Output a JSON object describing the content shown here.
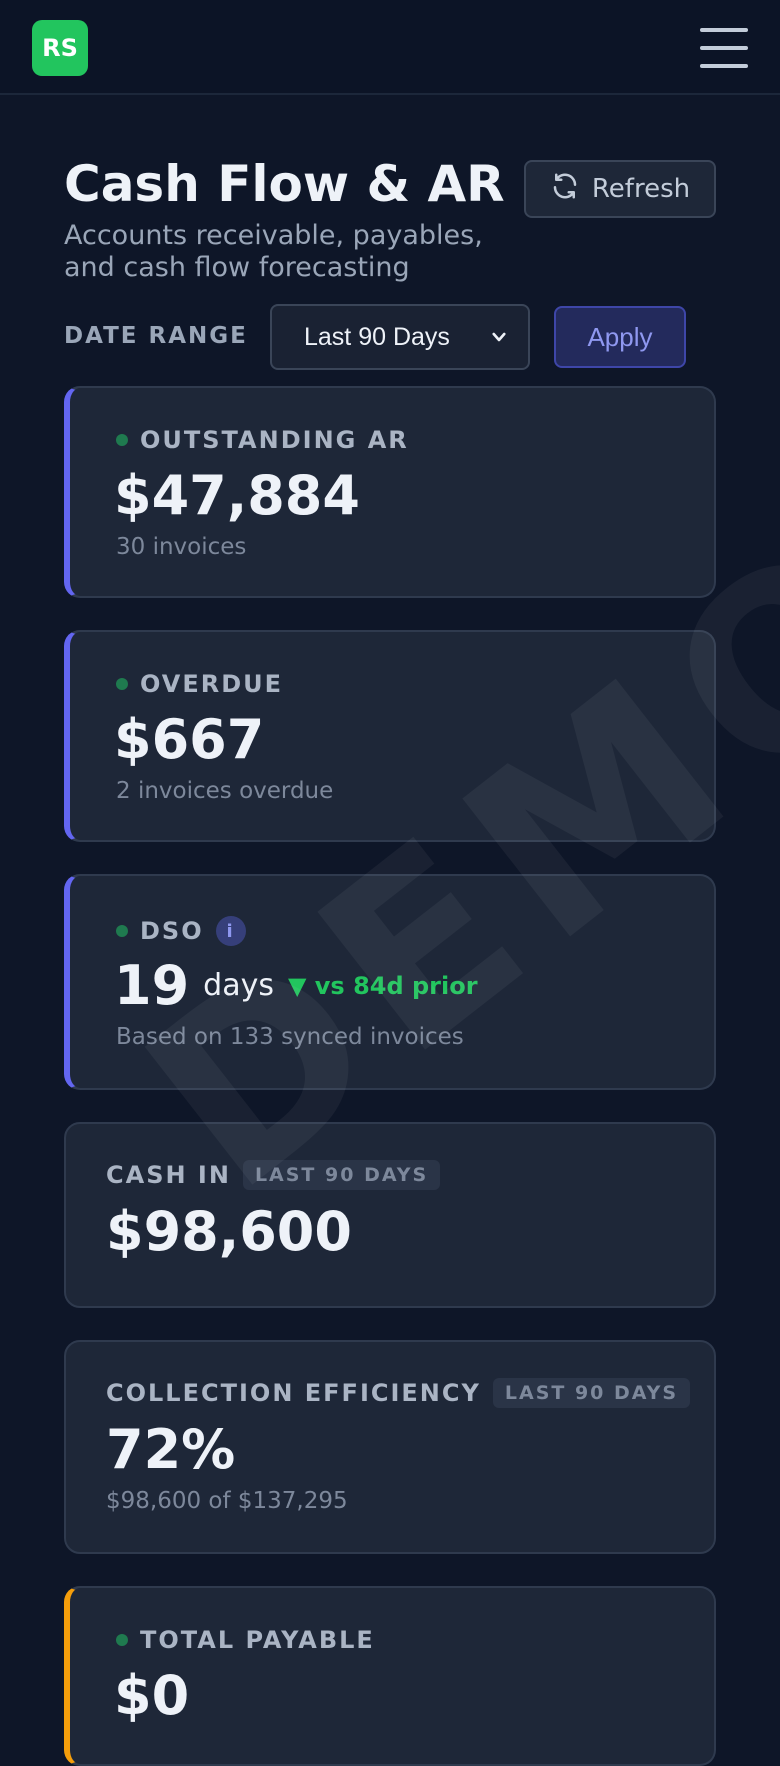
{
  "header": {
    "logo_text": "RS",
    "menu_icon": "hamburger-menu-icon"
  },
  "page": {
    "title": "Cash Flow & AR",
    "subtitle": "Accounts receivable, payables, and cash flow forecasting",
    "refresh_label": "Refresh",
    "refresh_icon": "refresh-icon"
  },
  "filters": {
    "date_range_label": "DATE RANGE",
    "date_range_value": "Last 90 Days",
    "apply_label": "Apply"
  },
  "cards": {
    "outstanding_ar": {
      "label": "OUTSTANDING AR",
      "value": "$47,884",
      "sub": "30 invoices"
    },
    "overdue": {
      "label": "OVERDUE",
      "value": "$667",
      "sub": "2 invoices overdue"
    },
    "dso": {
      "label": "DSO",
      "info": "i",
      "value": "19",
      "unit": "days",
      "trend": "▼ vs 84d prior",
      "sub": "Based on 133 synced invoices"
    },
    "cash_in": {
      "label": "CASH IN",
      "badge": "LAST 90 DAYS",
      "value": "$98,600"
    },
    "collection_efficiency": {
      "label": "COLLECTION EFFICIENCY",
      "badge": "LAST 90 DAYS",
      "value": "72%",
      "sub": "$98,600 of $137,295"
    },
    "total_payable": {
      "label": "TOTAL PAYABLE",
      "value": "$0"
    }
  },
  "watermark": "DEMO",
  "colors": {
    "background": "#0e1628",
    "card": "#1e2738",
    "accent_indigo": "#6366f1",
    "accent_orange": "#f59e0b",
    "positive_green": "#22c55e",
    "logo_green": "#22c55e"
  }
}
